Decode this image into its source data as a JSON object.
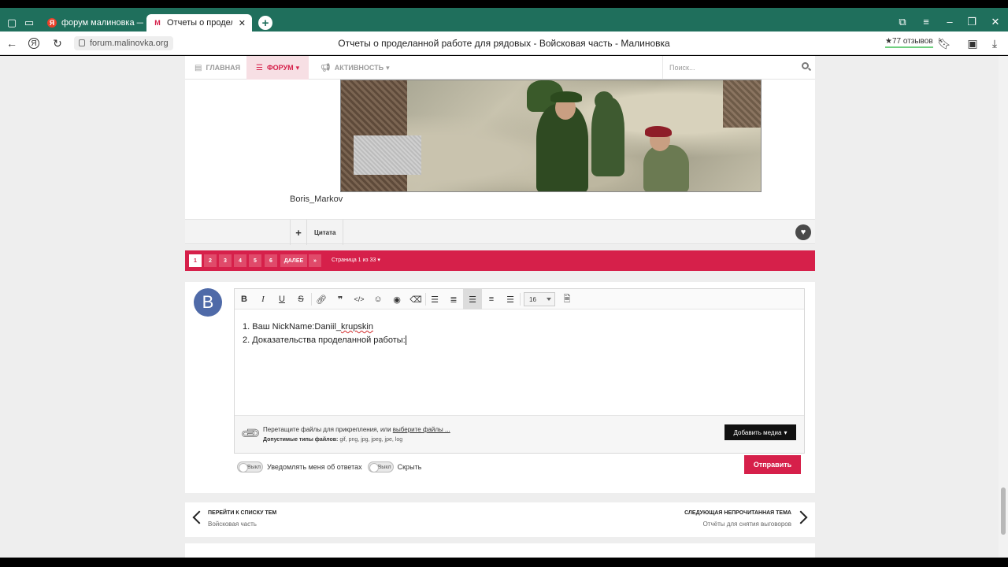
{
  "browser": {
    "tabs": [
      {
        "label": "форум малиновка — Янд",
        "icon": "yandex-icon",
        "active": false
      },
      {
        "label": "Отчеты о проделанной",
        "icon": "malinovka-icon",
        "active": true
      }
    ],
    "url": "forum.malinovka.org",
    "page_title": "Отчеты о проделанной работе для рядовых - Войсковая часть - Малиновка",
    "reviews": "★77 отзывов"
  },
  "site_nav": {
    "items": [
      {
        "label": "ГЛАВНАЯ",
        "icon": "home-icon"
      },
      {
        "label": "ФОРУМ",
        "icon": "list-icon",
        "active": true
      },
      {
        "label": "АКТИВНОСТЬ",
        "icon": "megaphone-icon"
      }
    ],
    "search_placeholder": "Поиск..."
  },
  "post": {
    "author": "Boris_Markov",
    "quote_label": "Цитата"
  },
  "pagination": {
    "pages": [
      "1",
      "2",
      "3",
      "4",
      "5",
      "6"
    ],
    "current": "1",
    "next_label": "ДАЛЕЕ",
    "last_label": "»",
    "info": "Страница 1 из 33"
  },
  "reply": {
    "avatar_letter": "B",
    "font_size": "16",
    "lines": [
      {
        "num": "1.",
        "text": "Ваш NickName:Daniil_",
        "spell": "krupskin"
      },
      {
        "num": "2.",
        "text": "Доказательства проделанной работы:"
      }
    ],
    "attach_text": "Перетащите файлы для прикрепления, или ",
    "attach_link": "выберите файлы ...",
    "types_label": "Допустимые типы файлов:",
    "types": "gif, png, jpg, jpeg, jpe, log",
    "add_media": "Добавить медиа",
    "toggle_off": "Выкл",
    "notify_label": "Уведомлять меня об ответах",
    "hide_label": "Скрыть",
    "send_label": "Отправить"
  },
  "thread_nav": {
    "back_title": "ПЕРЕЙТИ К СПИСКУ ТЕМ",
    "back_sub": "Войсковая часть",
    "next_title": "СЛЕДУЮЩАЯ НЕПРОЧИТАННАЯ ТЕМА",
    "next_sub": "Отчёты для снятия выговоров"
  },
  "colors": {
    "accent": "#d6204a",
    "tabbar": "#1f6f5c"
  }
}
